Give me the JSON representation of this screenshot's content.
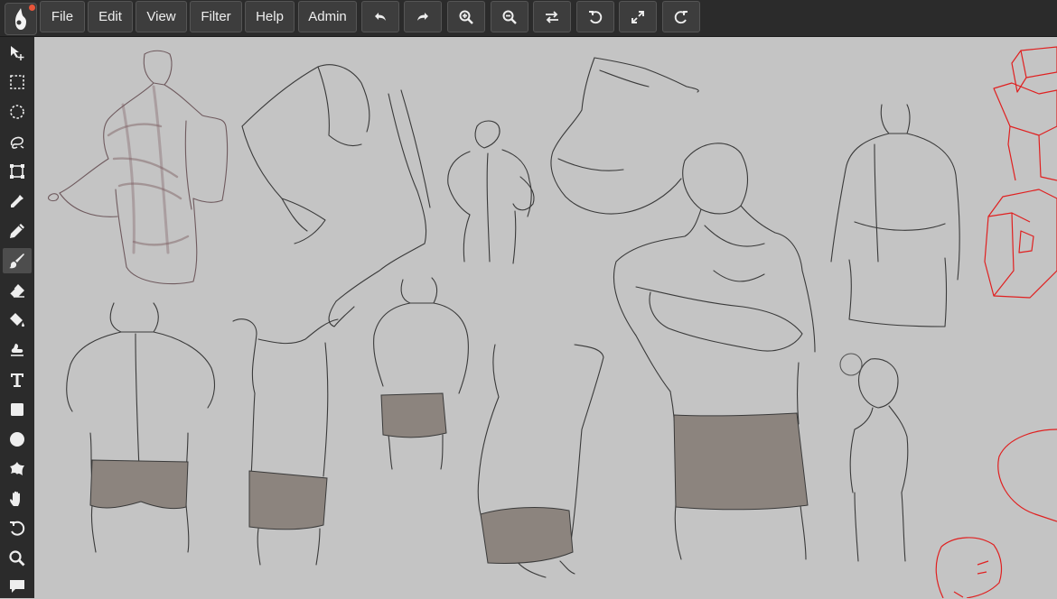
{
  "app": {
    "logo_icon": "drawing-app-logo",
    "notification_color": "#e8553a"
  },
  "menu": [
    "File",
    "Edit",
    "View",
    "Filter",
    "Help",
    "Admin"
  ],
  "actions": [
    {
      "name": "undo",
      "icon": "undo-icon"
    },
    {
      "name": "redo",
      "icon": "redo-icon"
    },
    {
      "name": "zoom-in",
      "icon": "zoom-in-icon"
    },
    {
      "name": "zoom-out",
      "icon": "zoom-out-icon"
    },
    {
      "name": "flip",
      "icon": "swap-icon"
    },
    {
      "name": "rotate-left",
      "icon": "rotate-left-icon"
    },
    {
      "name": "fullscreen",
      "icon": "expand-icon"
    },
    {
      "name": "rotate-right",
      "icon": "rotate-right-icon"
    }
  ],
  "tools": [
    {
      "name": "move",
      "icon": "move-icon"
    },
    {
      "name": "rect-select",
      "icon": "rect-select-icon"
    },
    {
      "name": "ellipse-select",
      "icon": "ellipse-select-icon"
    },
    {
      "name": "lasso",
      "icon": "lasso-icon"
    },
    {
      "name": "transform",
      "icon": "transform-icon"
    },
    {
      "name": "eyedropper",
      "icon": "eyedropper-icon"
    },
    {
      "name": "pen",
      "icon": "pen-icon"
    },
    {
      "name": "brush",
      "icon": "brush-icon",
      "active": true
    },
    {
      "name": "eraser",
      "icon": "eraser-icon"
    },
    {
      "name": "fill",
      "icon": "paint-bucket-icon"
    },
    {
      "name": "smudge",
      "icon": "smudge-icon"
    },
    {
      "name": "text",
      "icon": "text-icon"
    },
    {
      "name": "rectangle",
      "icon": "rectangle-icon"
    },
    {
      "name": "ellipse",
      "icon": "circle-icon"
    },
    {
      "name": "shape",
      "icon": "shape-icon"
    },
    {
      "name": "hand",
      "icon": "hand-icon"
    },
    {
      "name": "history",
      "icon": "history-icon"
    },
    {
      "name": "zoom",
      "icon": "search-icon"
    },
    {
      "name": "comment",
      "icon": "chat-icon"
    }
  ],
  "colors": {
    "ink": "#3a3a3a",
    "red_sketch": "#e02020",
    "sepia": "#7a5a5e",
    "shorts": "#8c847e",
    "canvas": "#c4c4c4"
  }
}
